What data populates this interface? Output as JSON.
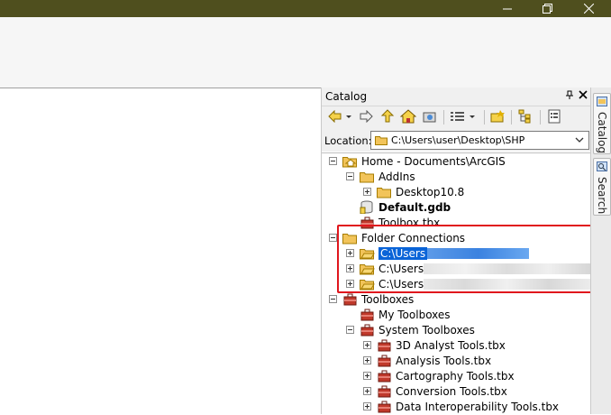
{
  "window": {
    "minimize_glyph": "—",
    "close_glyph": "✕"
  },
  "catalog": {
    "title": "Catalog",
    "pin_glyph": "ᵖ×",
    "location_label": "Location:",
    "location_value": "C:\\Users\\user\\Desktop\\SHP",
    "toolbar_icons": [
      "back-arrow-icon",
      "forward-arrow-icon",
      "up-one-level-icon",
      "home-icon",
      "connect-folder-icon",
      "views-icon",
      "new-item-icon",
      "tree-view-icon",
      "options-icon"
    ]
  },
  "tree": {
    "home": "Home - Documents\\ArcGIS",
    "addins": "AddIns",
    "desktop108": "Desktop10.8",
    "default_gdb": "Default.gdb",
    "toolbox_tbx": "Toolbox.tbx",
    "folder_connections": "Folder Connections",
    "conn1": "C:\\Users",
    "conn2": "C:\\Users",
    "conn3": "C:\\Users",
    "toolboxes": "Toolboxes",
    "my_toolboxes": "My Toolboxes",
    "system_toolboxes": "System Toolboxes",
    "tools": [
      "3D Analyst Tools.tbx",
      "Analysis Tools.tbx",
      "Cartography Tools.tbx",
      "Conversion Tools.tbx",
      "Data Interoperability Tools.tbx"
    ]
  },
  "side_tabs": {
    "catalog": "Catalog",
    "search": "Search"
  },
  "colors": {
    "titlebar": "#4f4f1e",
    "selection": "#0a64d8",
    "highlight_box": "#e0161d",
    "folder": "#f2c45a"
  }
}
